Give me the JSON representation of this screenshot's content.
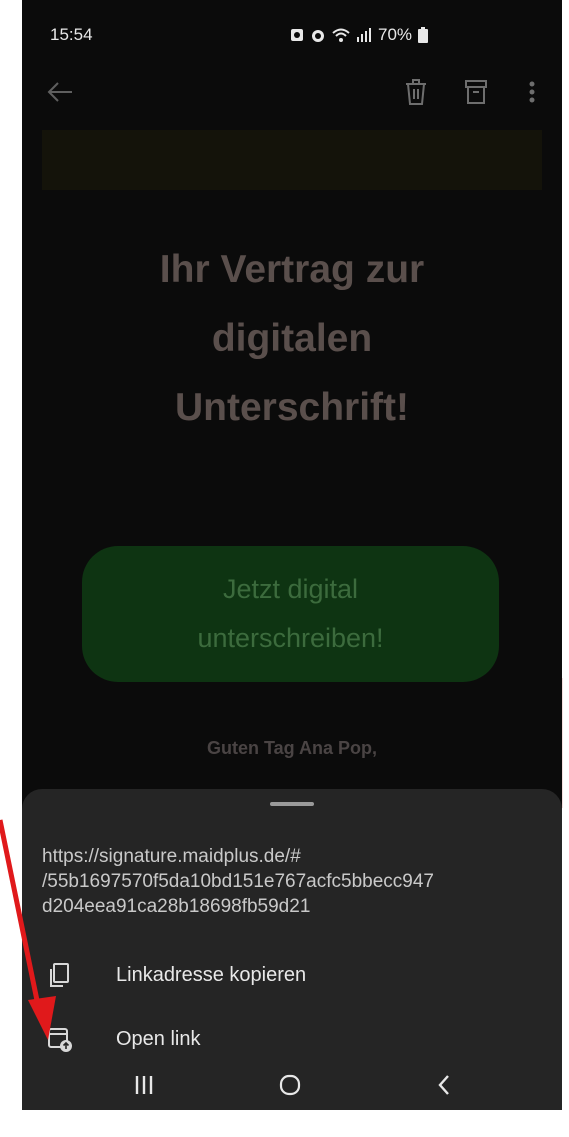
{
  "status_bar": {
    "time": "15:54",
    "battery": "70%",
    "icons": [
      "notification-icon",
      "alarm-icon",
      "wifi-icon",
      "signal-icon",
      "battery-icon"
    ]
  },
  "app_bar": {
    "icons": [
      "back-arrow-icon",
      "delete-icon",
      "archive-icon",
      "more-vert-icon"
    ]
  },
  "email": {
    "headline_lines": [
      "Ihr Vertrag zur",
      "digitalen",
      "Unterschrift!"
    ],
    "cta_lines": [
      "Jetzt digital",
      "unterschreiben!"
    ],
    "greeting": "Guten Tag Ana Pop,"
  },
  "sheet": {
    "url_lines": [
      "https://signature.maidplus.de/#",
      "/55b1697570f5da10bd151e767acfc5bbecc947",
      "d204eea91ca28b18698fb59d21"
    ],
    "items": [
      {
        "label": "Linkadresse kopieren",
        "icon": "copy-icon"
      },
      {
        "label": "Open link",
        "icon": "open-link-icon"
      }
    ]
  },
  "nav_bar": {
    "icons": [
      "recent-apps-icon",
      "home-icon",
      "back-icon"
    ]
  },
  "colors": {
    "screen_bg": "#0b0b0b",
    "sheet_bg": "#252525",
    "cta_bg": "#0e3412",
    "headline": "#5a4f4c",
    "annotation_arrow": "#e0191b"
  }
}
